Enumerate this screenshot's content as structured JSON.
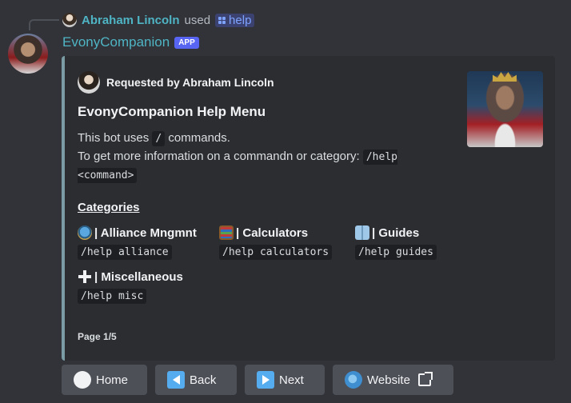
{
  "reply": {
    "user": "Abraham Lincoln",
    "used": "used",
    "command": "help"
  },
  "author": {
    "name": "EvonyCompanion",
    "badge": "APP"
  },
  "embed": {
    "requested_by": "Requested by Abraham Lincoln",
    "title": "EvonyCompanion Help Menu",
    "desc_line1_pre": "This bot uses",
    "desc_line1_code": "/",
    "desc_line1_post": "commands.",
    "desc_line2_pre": "To get more information on a commandn or category:",
    "desc_line2_code": "/help <command>",
    "categories_heading": "Categories",
    "fields": [
      {
        "name": "| Alliance Mngmnt",
        "value": "/help alliance",
        "icon": "globe-icon"
      },
      {
        "name": "| Calculators",
        "value": "/help calculators",
        "icon": "abacus-icon"
      },
      {
        "name": "| Guides",
        "value": "/help guides",
        "icon": "book-icon"
      },
      {
        "name": "| Miscellaneous",
        "value": "/help misc",
        "icon": "plus-icon"
      }
    ],
    "footer": "Page 1/5",
    "accent_color": "#7b9ba5"
  },
  "buttons": {
    "home": "Home",
    "back": "Back",
    "next": "Next",
    "website": "Website"
  }
}
